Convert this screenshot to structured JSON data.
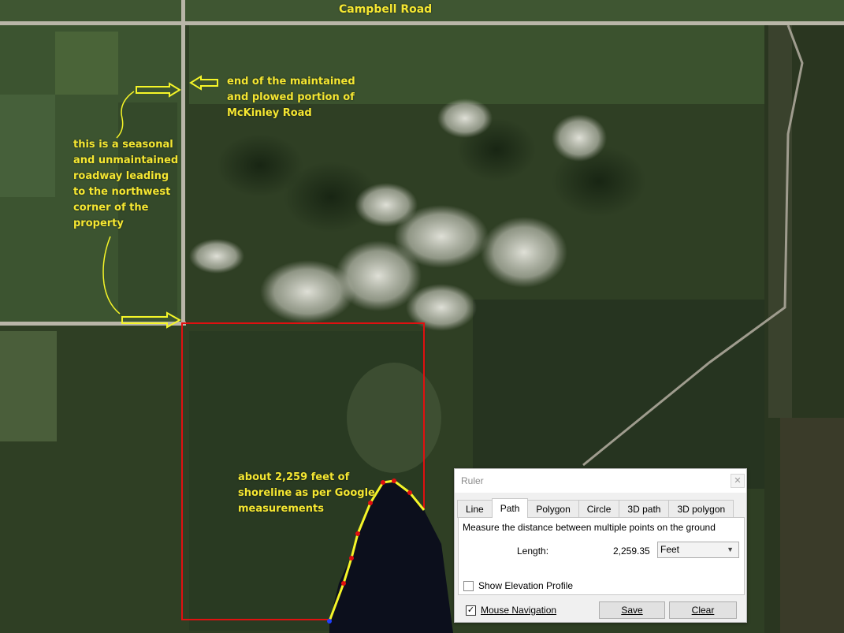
{
  "map": {
    "road_label": "Campbell Road",
    "annotation_end": "end of the maintained\nand plowed portion of\nMcKinley Road",
    "annotation_seasonal": "this is a seasonal\nand unmaintained\nroadway leading\nto the northwest\n corner of the\n property",
    "annotation_shoreline": "about 2,259 feet of\nshoreline as per Google\nmeasurements",
    "colors": {
      "boundary": "#e01010",
      "path": "#f5f528",
      "annotation": "#f5e732"
    }
  },
  "ruler": {
    "title": "Ruler",
    "close_icon": "close-icon",
    "tabs": [
      "Line",
      "Path",
      "Polygon",
      "Circle",
      "3D path",
      "3D polygon"
    ],
    "active_tab": "Path",
    "description": "Measure the distance between multiple points on the ground",
    "length_label": "Length:",
    "length_value": "2,259.35",
    "unit": "Feet",
    "show_elevation_label": "Show Elevation Profile",
    "mouse_navigation_label": "Mouse Navigation",
    "mouse_navigation_checked": true,
    "save_label": "Save",
    "clear_label": "Clear"
  }
}
